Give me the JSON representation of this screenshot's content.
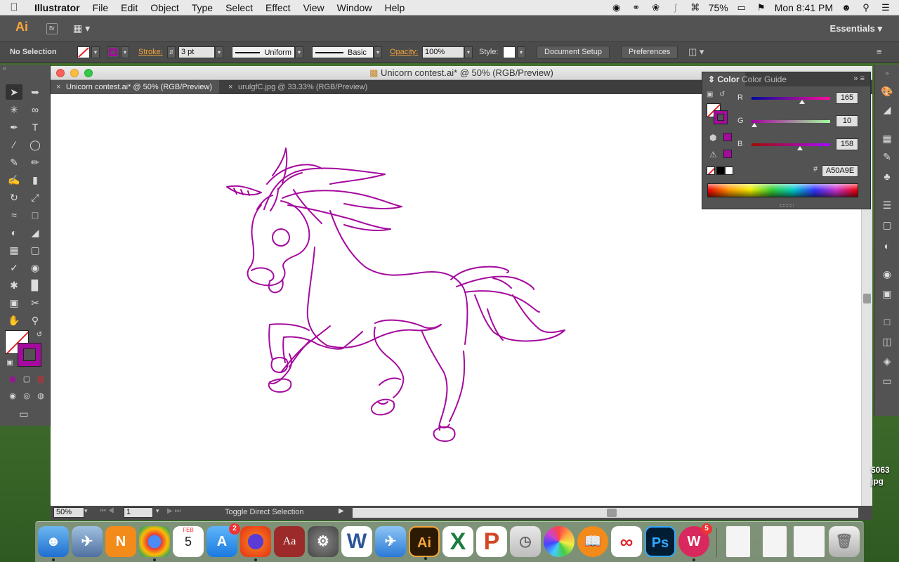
{
  "menubar": {
    "app_name": "Illustrator",
    "items": [
      "File",
      "Edit",
      "Object",
      "Type",
      "Select",
      "Effect",
      "View",
      "Window",
      "Help"
    ],
    "battery": "75%",
    "clock": "Mon 8:41 PM"
  },
  "appbar": {
    "logo": "Ai",
    "bridge": "Br",
    "workspace": "Essentials"
  },
  "controlbar": {
    "selection": "No Selection",
    "stroke_label": "Stroke:",
    "stroke_value": "3 pt",
    "profile": "Uniform",
    "brush": "Basic",
    "opacity_label": "Opacity:",
    "opacity_value": "100%",
    "style_label": "Style:",
    "document_setup": "Document Setup",
    "preferences": "Preferences"
  },
  "document": {
    "window_title": "Unicorn contest.ai* @ 50% (RGB/Preview)",
    "tabs": [
      {
        "label": "Unicorn contest.ai* @ 50% (RGB/Preview)",
        "active": true
      },
      {
        "label": "urulgfC.jpg @ 33.33% (RGB/Preview)",
        "active": false
      }
    ],
    "stroke_color": "#A50A9E"
  },
  "statusbar": {
    "zoom": "50%",
    "artboard": "1",
    "status_text": "Toggle Direct Selection"
  },
  "color_panel": {
    "tab_color": "Color",
    "tab_guide": "Color Guide",
    "r_label": "R",
    "r_value": "165",
    "g_label": "G",
    "g_value": "10",
    "b_label": "B",
    "b_value": "158",
    "hash": "#",
    "hex": "A50A9E"
  },
  "desktop": {
    "file_label_1": "5063",
    "file_label_2": "jpg"
  },
  "dock": {
    "calendar_month": "FEB",
    "calendar_day": "5",
    "appstore_badge": "2",
    "wunderlist_badge": "5",
    "ai_label": "Ai",
    "ps_label": "Ps"
  }
}
